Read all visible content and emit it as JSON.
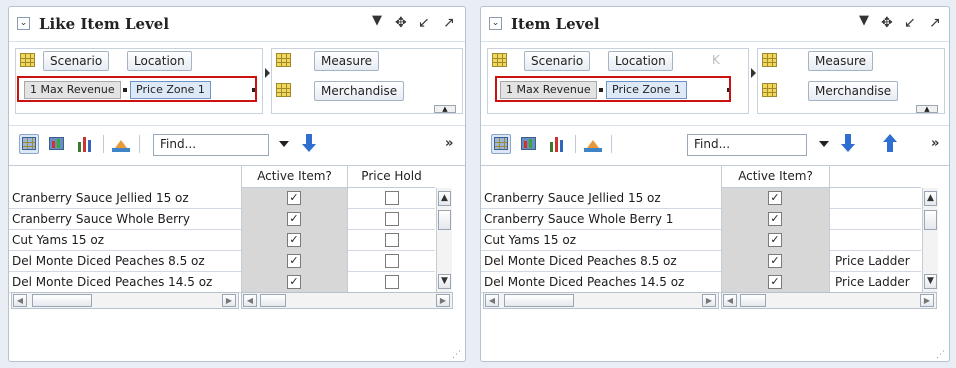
{
  "left_panel": {
    "title": "Like Item Level",
    "dims_left": [
      "Scenario",
      "Location"
    ],
    "chips": [
      "1 Max Revenue",
      "Price Zone 1"
    ],
    "dims_right": [
      "Measure",
      "Merchandise"
    ],
    "find_placeholder": "Find...",
    "columns": [
      "Active Item?",
      "Price Hold"
    ],
    "rows": [
      {
        "label": "Cranberry Sauce Jellied 15 oz",
        "active": true,
        "hold": false
      },
      {
        "label": "Cranberry Sauce Whole Berry",
        "active": true,
        "hold": false
      },
      {
        "label": "Cut Yams 15 oz",
        "active": true,
        "hold": false
      },
      {
        "label": "Del Monte Diced Peaches 8.5 oz",
        "active": true,
        "hold": false
      },
      {
        "label": "Del Monte Diced Peaches 14.5 oz",
        "active": true,
        "hold": false
      }
    ]
  },
  "right_panel": {
    "title": "Item Level",
    "dims_left": [
      "Scenario",
      "Location"
    ],
    "chips": [
      "1 Max Revenue",
      "Price Zone 1"
    ],
    "dims_right": [
      "Measure",
      "Merchandise"
    ],
    "find_placeholder": "Find...",
    "columns": [
      "Active Item?",
      ""
    ],
    "rows": [
      {
        "label": "Cranberry Sauce Jellied 15 oz",
        "active": true,
        "text": ""
      },
      {
        "label": "Cranberry Sauce Whole Berry 1",
        "active": true,
        "text": ""
      },
      {
        "label": "Cut Yams 15 oz",
        "active": true,
        "text": ""
      },
      {
        "label": "Del Monte Diced Peaches 8.5 oz",
        "active": true,
        "text": "Price Ladder"
      },
      {
        "label": "Del Monte Diced Peaches 14.5 oz",
        "active": true,
        "text": "Price Ladder"
      }
    ]
  },
  "glyphs": {
    "check": "✓",
    "collapse": "⌄",
    "move": "✥",
    "minimize": "↙",
    "maximize": "↗",
    "more": "»",
    "up": "▲",
    "down": "▼",
    "left": "◀",
    "right": "▶",
    "grip": "⋰"
  },
  "colors": {
    "highlight_box": "#cc1111",
    "grey_cell": "#d7d7d7",
    "selected_chip": "#dde9f7"
  }
}
